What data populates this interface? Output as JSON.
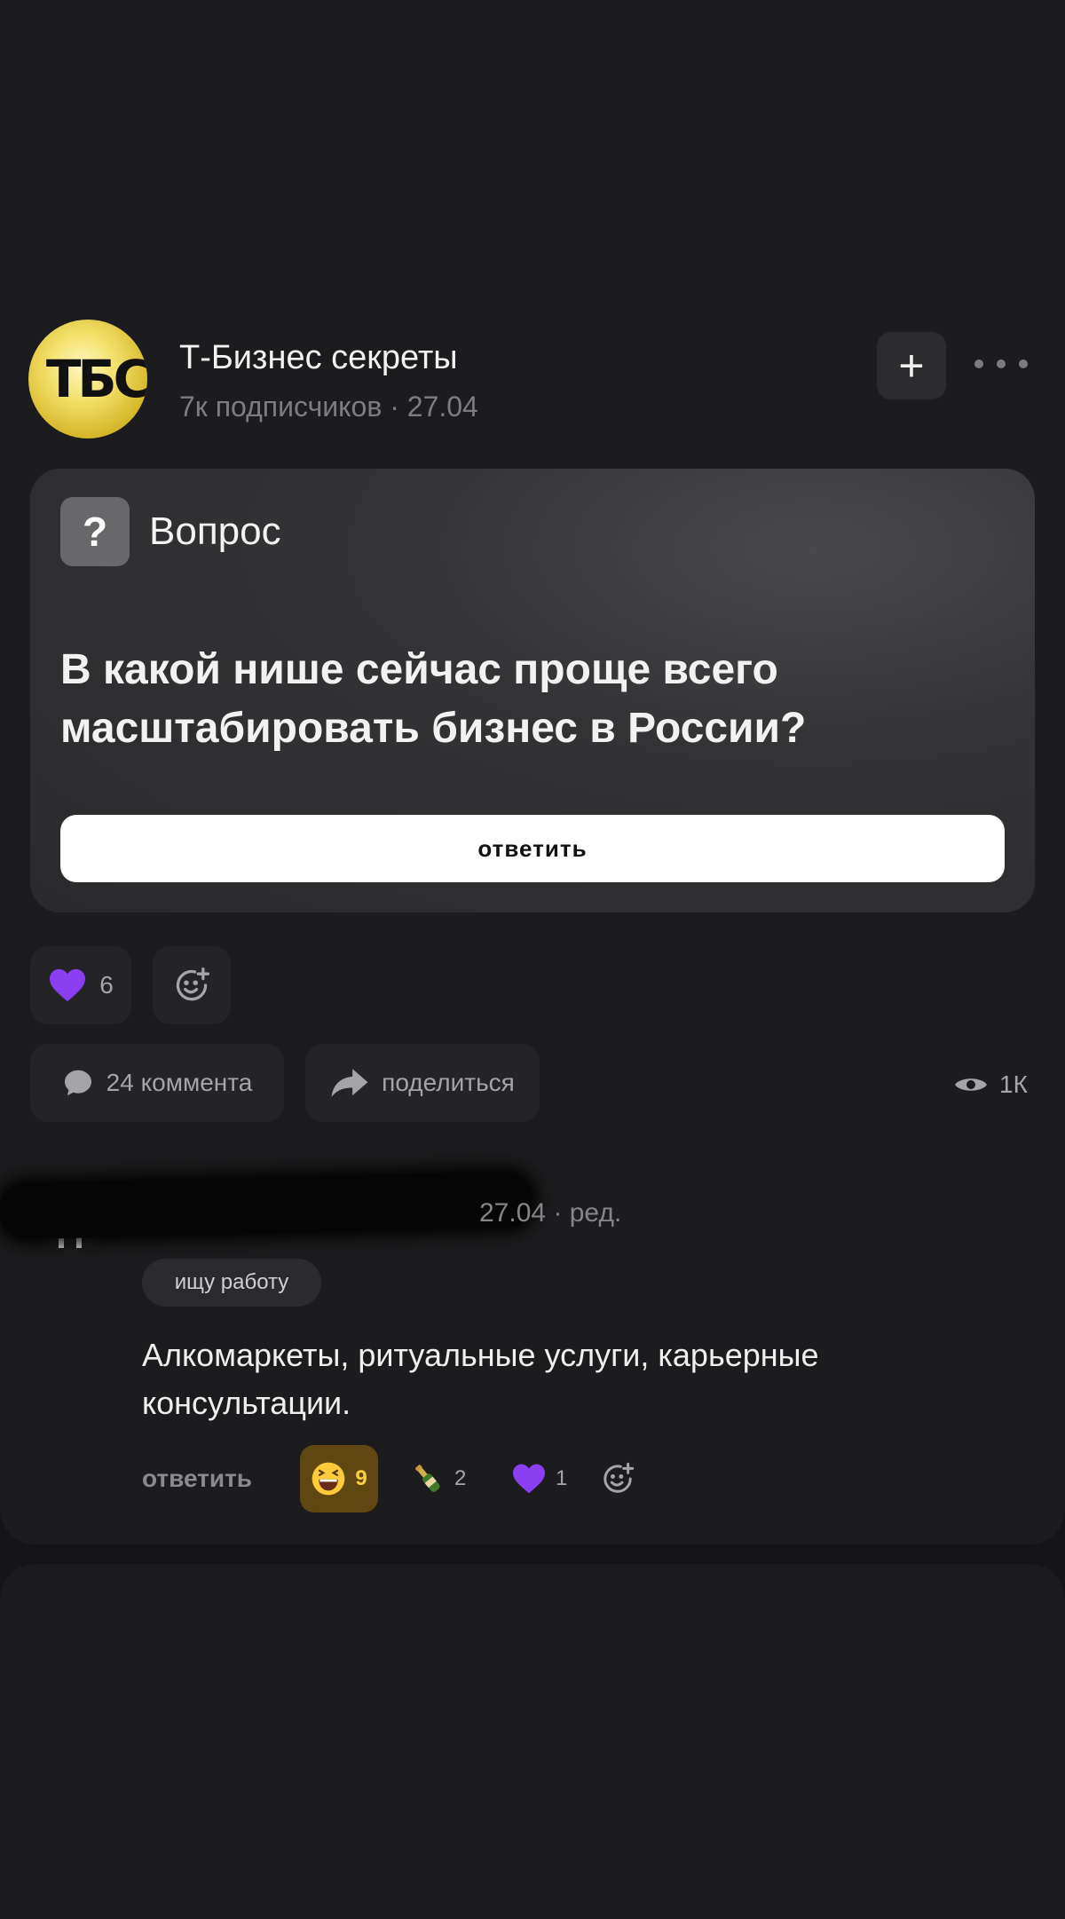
{
  "channel": {
    "avatar_text": "ТБС",
    "name": "Т-Бизнес секреты",
    "meta": "7к подписчиков · 27.04"
  },
  "question": {
    "badge": "?",
    "label": "Вопрос",
    "text": "В какой нише сейчас проще всего масштабировать бизнес в России?",
    "answer_label": "ответить"
  },
  "reactions": {
    "heart_count": "6"
  },
  "actions": {
    "comments_label": "24 коммента",
    "share_label": "поделиться",
    "views": "1К"
  },
  "comment": {
    "meta": "27.04 · ред.",
    "tag": "ищу работу",
    "text": "Алкомаркеты, ритуальные услуги, карьерные консультации.",
    "reply_label": "ответить",
    "reactions": [
      {
        "icon": "laughing-emoji-icon",
        "count": "9"
      },
      {
        "icon": "champagne-bottle-icon",
        "count": "2"
      },
      {
        "icon": "purple-heart-icon",
        "count": "1"
      }
    ]
  },
  "colors": {
    "background": "#151517",
    "card": "#1c1c1e",
    "accent_heart": "#8a3ff0",
    "highlight_reaction": "#5e4711"
  }
}
